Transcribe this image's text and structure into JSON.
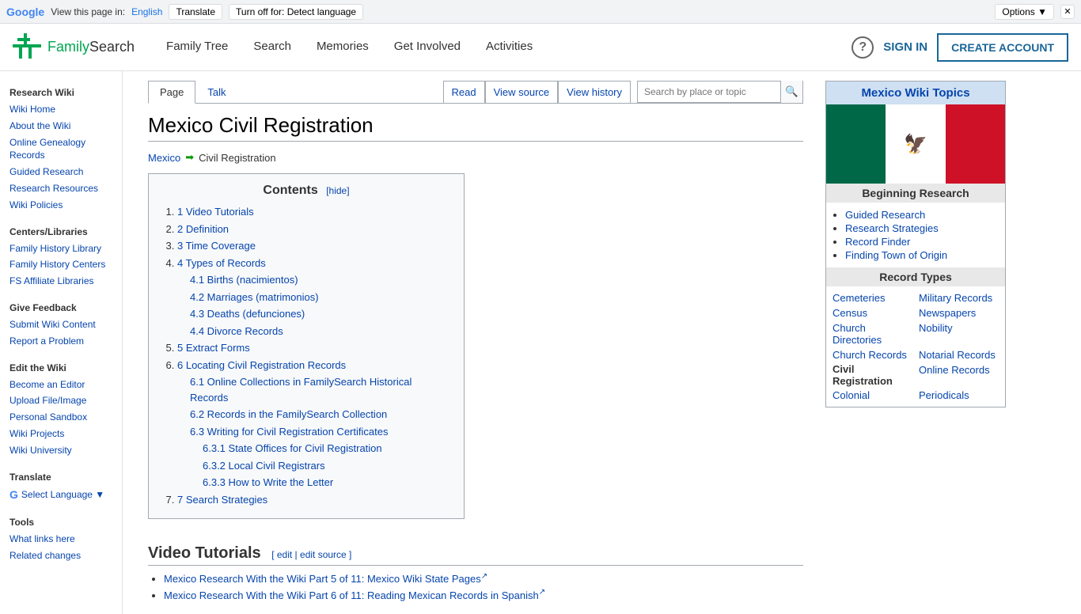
{
  "translate_bar": {
    "google_label": "Google",
    "view_page_text": "View this page in:",
    "language_link": "English",
    "translate_btn": "Translate",
    "turn_off_btn": "Turn off for: Detect language",
    "options_btn": "Options ▼",
    "close_btn": "✕"
  },
  "nav": {
    "logo_text1": "Family",
    "logo_text2": "Search",
    "links": [
      {
        "label": "Family Tree",
        "href": "#"
      },
      {
        "label": "Search",
        "href": "#"
      },
      {
        "label": "Memories",
        "href": "#"
      },
      {
        "label": "Get Involved",
        "href": "#"
      },
      {
        "label": "Activities",
        "href": "#"
      }
    ],
    "sign_in": "SIGN IN",
    "create_account": "CREATE ACCOUNT"
  },
  "sidebar": {
    "sections": [
      {
        "title": "Research Wiki",
        "items": [
          {
            "label": "Wiki Home",
            "href": "#"
          },
          {
            "label": "About the Wiki",
            "href": "#"
          },
          {
            "label": "Online Genealogy Records",
            "href": "#"
          },
          {
            "label": "Guided Research",
            "href": "#"
          },
          {
            "label": "Research Resources",
            "href": "#"
          },
          {
            "label": "Wiki Policies",
            "href": "#"
          }
        ]
      },
      {
        "title": "Centers/Libraries",
        "items": [
          {
            "label": "Family History Library",
            "href": "#"
          },
          {
            "label": "Family History Centers",
            "href": "#"
          },
          {
            "label": "FS Affiliate Libraries",
            "href": "#"
          }
        ]
      },
      {
        "title": "Give Feedback",
        "items": [
          {
            "label": "Submit Wiki Content",
            "href": "#"
          },
          {
            "label": "Report a Problem",
            "href": "#"
          }
        ]
      },
      {
        "title": "Edit the Wiki",
        "items": [
          {
            "label": "Become an Editor",
            "href": "#"
          },
          {
            "label": "Upload File/Image",
            "href": "#"
          },
          {
            "label": "Personal Sandbox",
            "href": "#"
          },
          {
            "label": "Wiki Projects",
            "href": "#"
          },
          {
            "label": "Wiki University",
            "href": "#"
          }
        ]
      },
      {
        "title": "Translate",
        "items": [
          {
            "label": "Select Language ▼",
            "href": "#"
          }
        ]
      },
      {
        "title": "Tools",
        "items": [
          {
            "label": "What links here",
            "href": "#"
          },
          {
            "label": "Related changes",
            "href": "#"
          }
        ]
      }
    ]
  },
  "page": {
    "tabs": [
      "Page",
      "Talk"
    ],
    "active_tab": "Page",
    "actions": [
      "Read",
      "View source",
      "View history"
    ],
    "search_placeholder": "Search by place or topic",
    "title": "Mexico Civil Registration",
    "breadcrumb_link": "Mexico",
    "breadcrumb_page": "Civil Registration",
    "toc_title": "Contents",
    "toc_hide": "[hide]",
    "toc_items": [
      {
        "num": "1",
        "label": "Video Tutorials",
        "sub": []
      },
      {
        "num": "2",
        "label": "Definition",
        "sub": []
      },
      {
        "num": "3",
        "label": "Time Coverage",
        "sub": []
      },
      {
        "num": "4",
        "label": "Types of Records",
        "sub": [
          {
            "num": "4.1",
            "label": "Births (nacimientos)"
          },
          {
            "num": "4.2",
            "label": "Marriages (matrimonios)"
          },
          {
            "num": "4.3",
            "label": "Deaths (defunciones)"
          },
          {
            "num": "4.4",
            "label": "Divorce Records"
          }
        ]
      },
      {
        "num": "5",
        "label": "Extract Forms",
        "sub": []
      },
      {
        "num": "6",
        "label": "Locating Civil Registration Records",
        "sub": [
          {
            "num": "6.1",
            "label": "Online Collections in FamilySearch Historical Records"
          },
          {
            "num": "6.2",
            "label": "Records in the FamilySearch Collection"
          },
          {
            "num": "6.3",
            "label": "Writing for Civil Registration Certificates",
            "sub2": [
              {
                "num": "6.3.1",
                "label": "State Offices for Civil Registration"
              },
              {
                "num": "6.3.2",
                "label": "Local Civil Registrars"
              },
              {
                "num": "6.3.3",
                "label": "How to Write the Letter"
              }
            ]
          }
        ]
      },
      {
        "num": "7",
        "label": "Search Strategies",
        "sub": []
      }
    ],
    "video_section_title": "Video Tutorials",
    "video_edit": "edit",
    "video_edit_source": "edit source",
    "video_links": [
      {
        "label": "Mexico Research With the Wiki Part 5 of 11: Mexico Wiki State Pages",
        "href": "#",
        "external": true
      },
      {
        "label": "Mexico Research With the Wiki Part 6 of 11: Reading Mexican Records in Spanish",
        "href": "#",
        "external": true
      }
    ]
  },
  "right_sidebar": {
    "topics_title": "Mexico Wiki Topics",
    "flag_eagle": "🦅",
    "beginning_research_title": "Beginning Research",
    "beginning_research_links": [
      {
        "label": "Guided Research"
      },
      {
        "label": "Research Strategies"
      },
      {
        "label": "Record Finder"
      },
      {
        "label": "Finding Town of Origin"
      }
    ],
    "record_types_title": "Record Types",
    "record_types": [
      {
        "label": "Cemeteries",
        "col": 1
      },
      {
        "label": "Military Records",
        "col": 2
      },
      {
        "label": "Census",
        "col": 1
      },
      {
        "label": "Newspapers",
        "col": 2
      },
      {
        "label": "Church Directories",
        "col": 1
      },
      {
        "label": "Nobility",
        "col": 2
      },
      {
        "label": "Church Records",
        "col": 1
      },
      {
        "label": "Notarial Records",
        "col": 2
      },
      {
        "label": "Civil Registration",
        "col": 1,
        "bold": true
      },
      {
        "label": "Online Records",
        "col": 2
      },
      {
        "label": "Colonial",
        "col": 1
      },
      {
        "label": "Periodicals",
        "col": 2
      }
    ]
  }
}
